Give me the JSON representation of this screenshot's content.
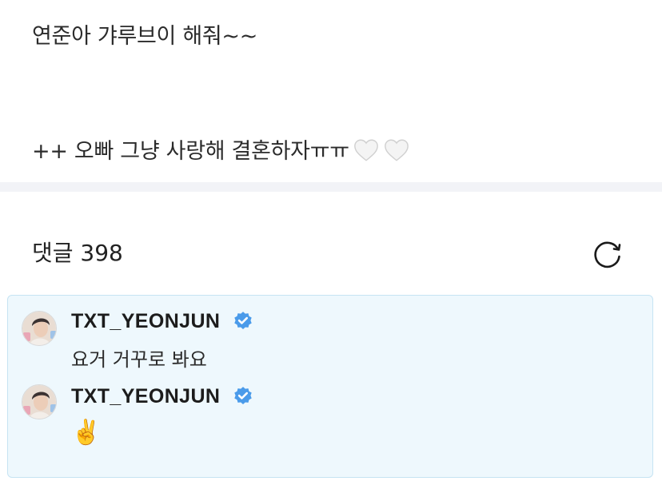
{
  "post": {
    "line1": "연준아 갸루브이 해줘~~",
    "line2_text": "++ 오빠 그냥 사랑해 결혼하자ㅠㅠ",
    "heart_icon": "white-heart-icon"
  },
  "comments": {
    "header": "댓글 398",
    "refresh_icon": "refresh-icon",
    "pinned": [
      {
        "username": "TXT_YEONJUN",
        "text": "요거 거꾸로 봐요",
        "verified_icon": "verified-badge-icon"
      },
      {
        "username": "TXT_YEONJUN",
        "text": "✌️",
        "verified_icon": "verified-badge-icon"
      }
    ]
  },
  "colors": {
    "pinned_bg": "#eef8fd",
    "pinned_border": "#c6e4f3",
    "verified_blue": "#4a9bea",
    "divider": "#f2f3f7"
  }
}
